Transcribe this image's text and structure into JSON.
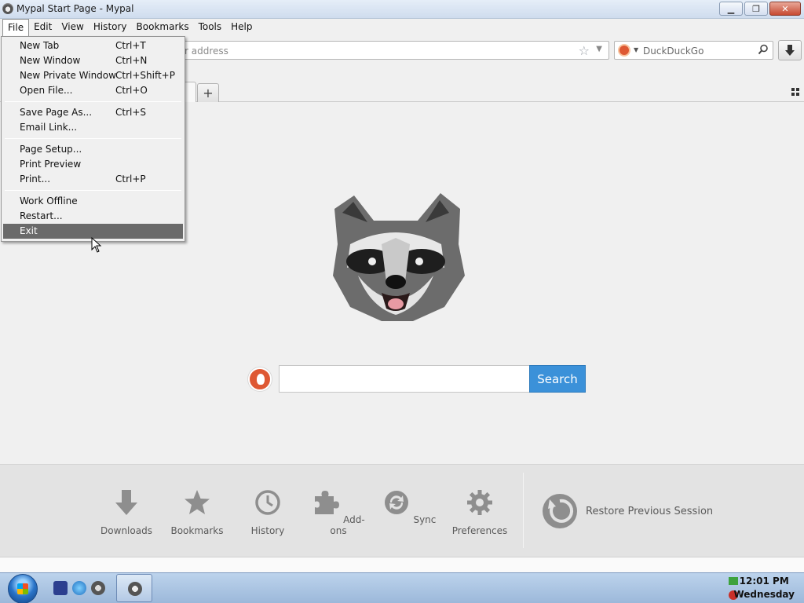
{
  "window": {
    "title": "Mypal Start Page - Mypal"
  },
  "menubar": [
    "File",
    "Edit",
    "View",
    "History",
    "Bookmarks",
    "Tools",
    "Help"
  ],
  "navbar": {
    "url_placeholder": "r address",
    "search_engine": "DuckDuckGo"
  },
  "file_menu": [
    {
      "label": "New Tab",
      "shortcut": "Ctrl+T"
    },
    {
      "label": "New Window",
      "shortcut": "Ctrl+N"
    },
    {
      "label": "New Private Window",
      "shortcut": "Ctrl+Shift+P"
    },
    {
      "label": "Open File...",
      "shortcut": "Ctrl+O"
    },
    {
      "sep": true
    },
    {
      "label": "Save Page As...",
      "shortcut": "Ctrl+S"
    },
    {
      "label": "Email Link...",
      "shortcut": ""
    },
    {
      "sep": true
    },
    {
      "label": "Page Setup...",
      "shortcut": ""
    },
    {
      "label": "Print Preview",
      "shortcut": ""
    },
    {
      "label": "Print...",
      "shortcut": "Ctrl+P"
    },
    {
      "sep": true
    },
    {
      "label": "Work Offline",
      "shortcut": ""
    },
    {
      "label": "Restart...",
      "shortcut": ""
    },
    {
      "label": "Exit",
      "shortcut": "",
      "highlighted": true
    }
  ],
  "start_page": {
    "search_button": "Search",
    "launcher": [
      {
        "label": "Downloads",
        "icon": "download-icon"
      },
      {
        "label": "Bookmarks",
        "icon": "star-icon"
      },
      {
        "label": "History",
        "icon": "clock-icon"
      },
      {
        "label": "Add-ons",
        "icon": "puzzle-icon"
      },
      {
        "label": "Sync",
        "icon": "sync-icon"
      },
      {
        "label": "Preferences",
        "icon": "gear-icon"
      }
    ],
    "restore_session": "Restore Previous Session"
  },
  "taskbar": {
    "time": "12:01 PM",
    "day": "Wednesday"
  },
  "colors": {
    "search_button": "#3b91d9",
    "menu_highlight": "#6a6a6a",
    "duckduckgo": "#de5833"
  }
}
